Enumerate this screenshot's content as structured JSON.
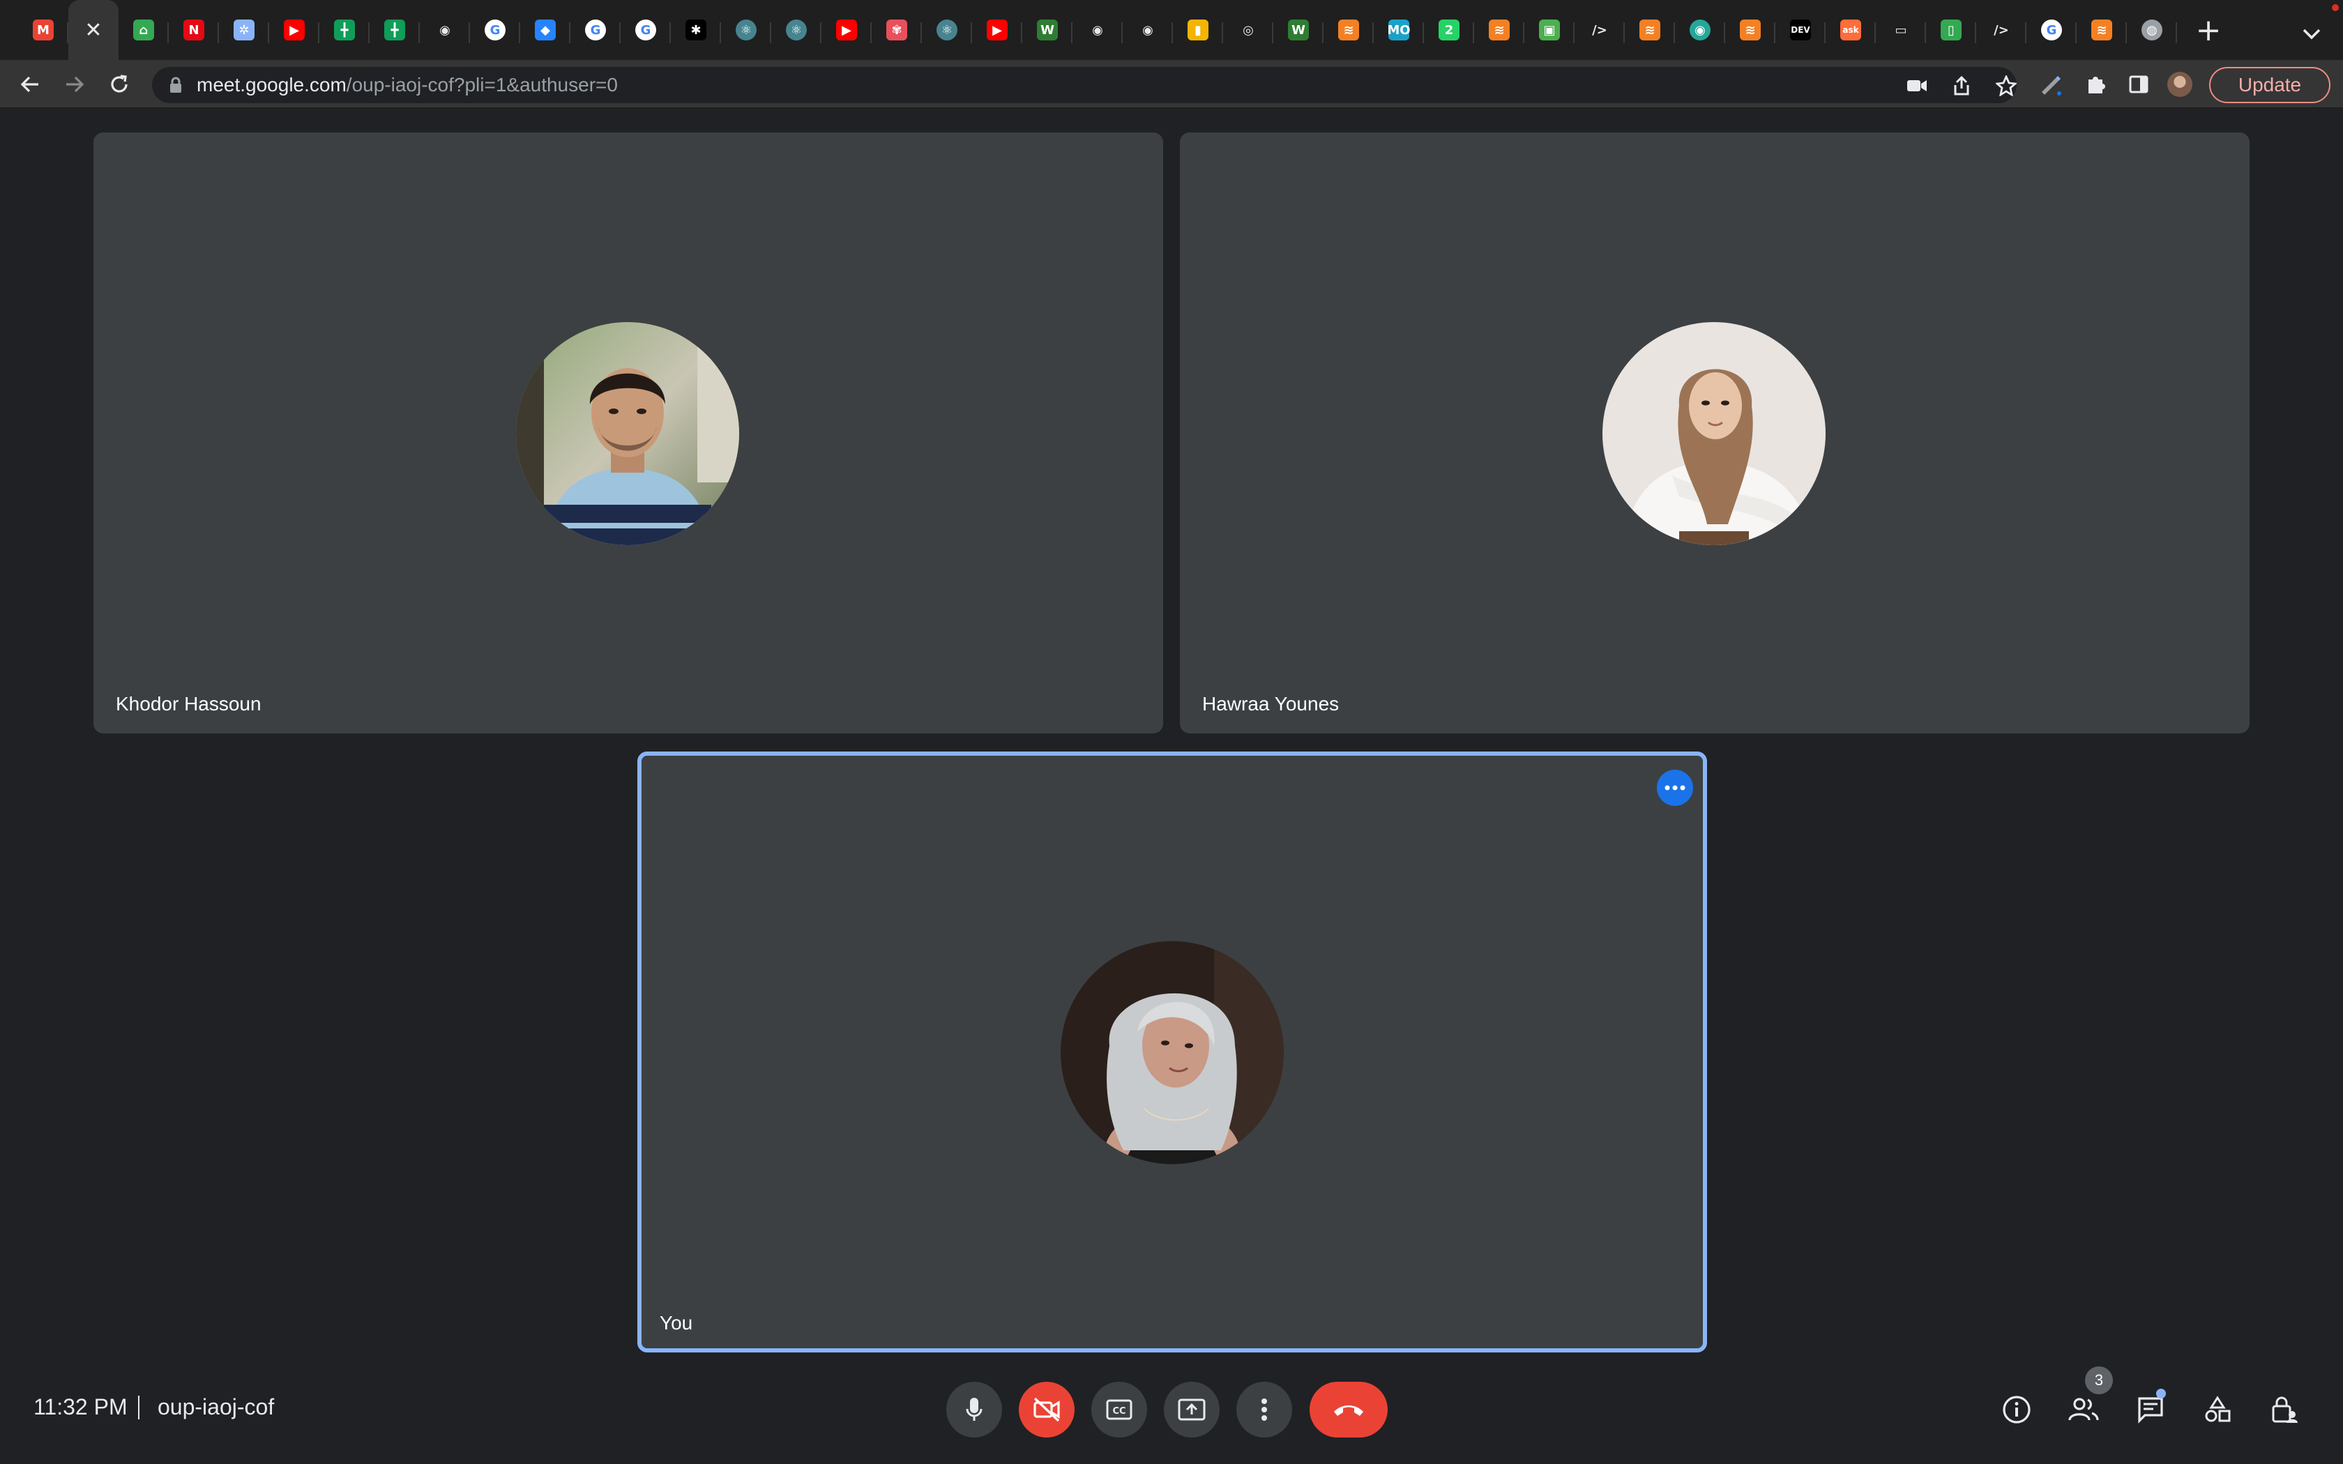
{
  "browser": {
    "tabs": [
      {
        "icon": "gmail-icon",
        "color": "#ea4335",
        "glyph": "M"
      },
      {
        "icon": "meet-tab-close-icon",
        "color": "#353535",
        "glyph": "✕",
        "active": true
      },
      {
        "icon": "google-maps-icon",
        "color": "#34a853",
        "glyph": "⌂"
      },
      {
        "icon": "netflix-icon",
        "color": "#e50914",
        "glyph": "N"
      },
      {
        "icon": "app-icon",
        "color": "#8ab4f8",
        "glyph": "✲"
      },
      {
        "icon": "youtube-icon",
        "color": "#ff0000",
        "glyph": "▶"
      },
      {
        "icon": "sheets-icon",
        "color": "#0f9d58",
        "glyph": "╋"
      },
      {
        "icon": "sheets-icon",
        "color": "#0f9d58",
        "glyph": "╋"
      },
      {
        "icon": "github-icon",
        "color": "#e8eaed",
        "glyph": "◉"
      },
      {
        "icon": "google-icon",
        "color": "#4285f4",
        "glyph": "G"
      },
      {
        "icon": "jira-icon",
        "color": "#2684ff",
        "glyph": "◆"
      },
      {
        "icon": "google-icon",
        "color": "#4285f4",
        "glyph": "G"
      },
      {
        "icon": "google-icon",
        "color": "#4285f4",
        "glyph": "G"
      },
      {
        "icon": "app-dark-icon",
        "color": "#000000",
        "glyph": "✱"
      },
      {
        "icon": "electron-icon",
        "color": "#47848f",
        "glyph": "⚛"
      },
      {
        "icon": "electron-icon",
        "color": "#47848f",
        "glyph": "⚛"
      },
      {
        "icon": "youtube-icon",
        "color": "#ff0000",
        "glyph": "▶"
      },
      {
        "icon": "app-red-icon",
        "color": "#e8505b",
        "glyph": "✾"
      },
      {
        "icon": "electron-icon",
        "color": "#47848f",
        "glyph": "⚛"
      },
      {
        "icon": "youtube-icon",
        "color": "#ff0000",
        "glyph": "▶"
      },
      {
        "icon": "w-icon",
        "color": "#2e7d32",
        "glyph": "W"
      },
      {
        "icon": "github-icon",
        "color": "#e8eaed",
        "glyph": "◉"
      },
      {
        "icon": "github-icon",
        "color": "#e8eaed",
        "glyph": "◉"
      },
      {
        "icon": "jar-icon",
        "color": "#f4b400",
        "glyph": "▮"
      },
      {
        "icon": "chrome-icon",
        "color": "#e8eaed",
        "glyph": "◎"
      },
      {
        "icon": "w-icon",
        "color": "#2e7d32",
        "glyph": "W"
      },
      {
        "icon": "stackoverflow-icon",
        "color": "#f48024",
        "glyph": "≋"
      },
      {
        "icon": "mo-icon",
        "color": "#1ba1c9",
        "glyph": "MO"
      },
      {
        "icon": "whatsapp-icon",
        "color": "#25d366",
        "glyph": "2"
      },
      {
        "icon": "stackoverflow-icon",
        "color": "#f48024",
        "glyph": "≋"
      },
      {
        "icon": "app-green-icon",
        "color": "#4caf50",
        "glyph": "▣"
      },
      {
        "icon": "code-icon",
        "color": "#e8eaed",
        "glyph": "/>"
      },
      {
        "icon": "stackoverflow-icon",
        "color": "#f48024",
        "glyph": "≋"
      },
      {
        "icon": "eye-icon",
        "color": "#26a69a",
        "glyph": "◉"
      },
      {
        "icon": "stackoverflow-icon",
        "color": "#f48024",
        "glyph": "≋"
      },
      {
        "icon": "dev-icon",
        "color": "#000000",
        "glyph": "DEV"
      },
      {
        "icon": "ask-icon",
        "color": "#ff6d3a",
        "glyph": "ask"
      },
      {
        "icon": "terminal-icon",
        "color": "#e8eaed",
        "glyph": "▭"
      },
      {
        "icon": "app-green2-icon",
        "color": "#34a853",
        "glyph": "▯"
      },
      {
        "icon": "code-icon",
        "color": "#e8eaed",
        "glyph": "/>"
      },
      {
        "icon": "google-icon",
        "color": "#4285f4",
        "glyph": "G"
      },
      {
        "icon": "stackoverflow-icon",
        "color": "#f48024",
        "glyph": "≋"
      },
      {
        "icon": "globe-icon",
        "color": "#9aa0a6",
        "glyph": "◍"
      }
    ],
    "url_host": "meet.google.com",
    "url_path": "/oup-iaoj-cof?pli=1&authuser=0",
    "update_label": "Update"
  },
  "meet": {
    "participants": [
      {
        "name": "Khodor Hassoun"
      },
      {
        "name": "Hawraa Younes"
      },
      {
        "name": "You"
      }
    ],
    "time": "11:32 PM",
    "meeting_code": "oup-iaoj-cof",
    "participant_count": "3",
    "colors": {
      "background": "#202124",
      "tile": "#3c4043",
      "accent": "#8ab4f8",
      "danger": "#ea4335"
    }
  }
}
